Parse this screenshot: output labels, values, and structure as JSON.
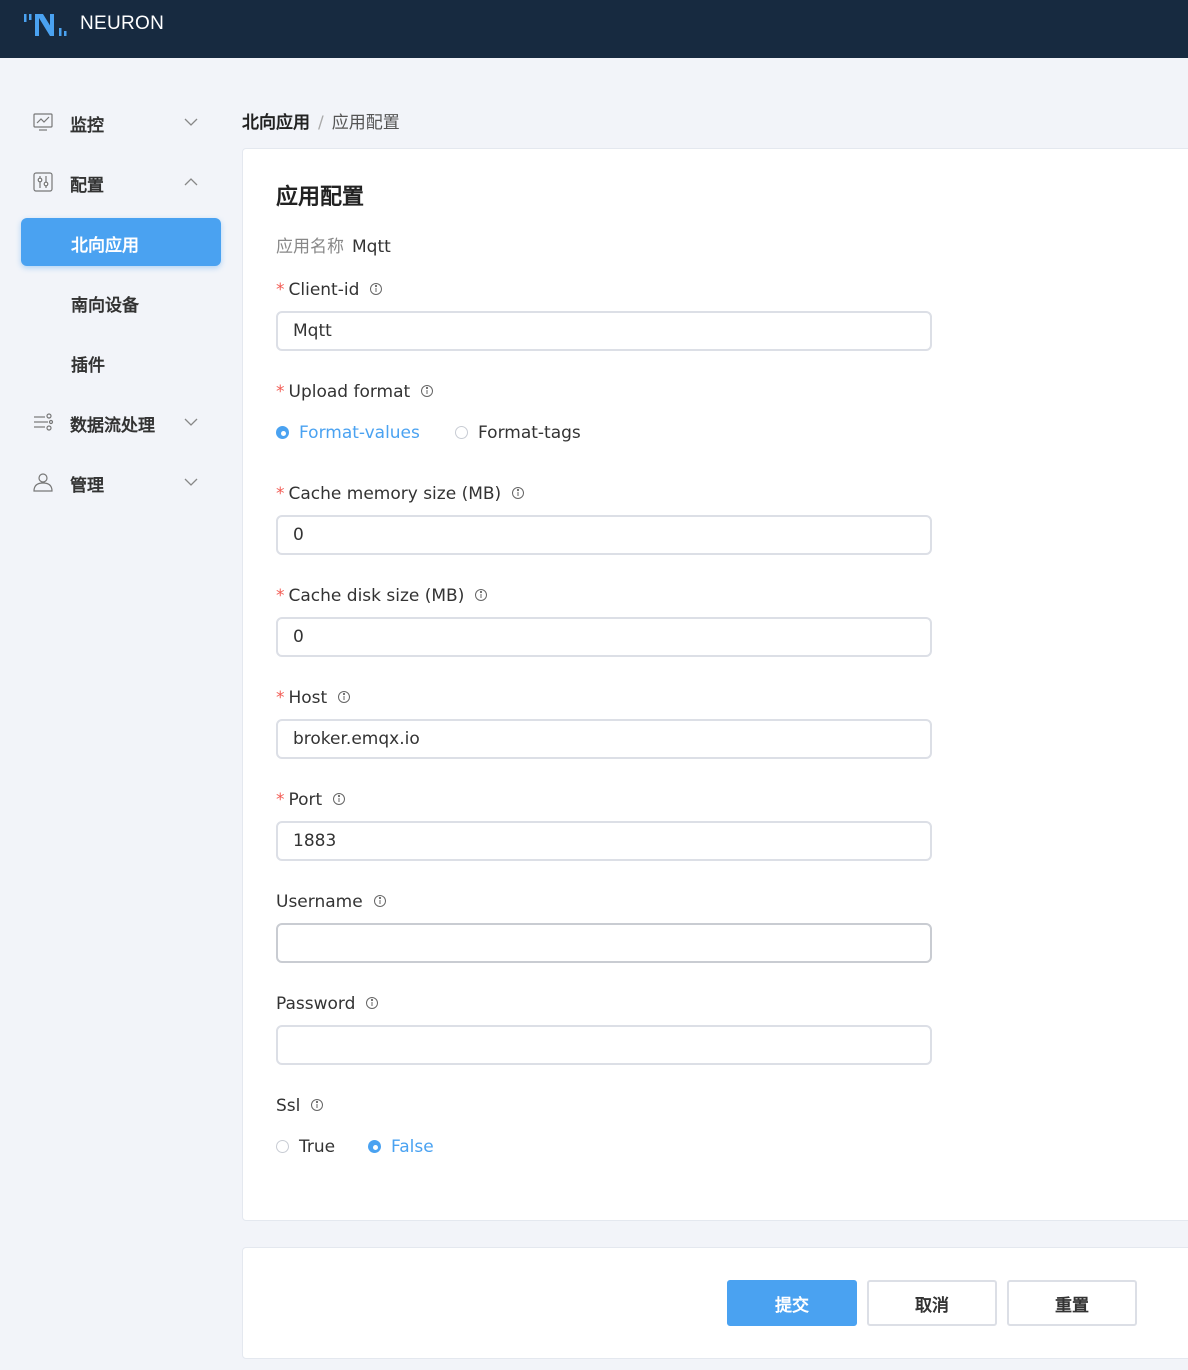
{
  "app": {
    "brand": "NEURON"
  },
  "sidebar": {
    "items": [
      {
        "label": "监控",
        "icon": "monitor-icon",
        "expanded": false
      },
      {
        "label": "配置",
        "icon": "config-icon",
        "expanded": true
      },
      {
        "label": "数据流处理",
        "icon": "dataflow-icon",
        "expanded": false
      },
      {
        "label": "管理",
        "icon": "user-icon",
        "expanded": false
      }
    ],
    "config_sub": [
      {
        "label": "北向应用",
        "active": true
      },
      {
        "label": "南向设备",
        "active": false
      },
      {
        "label": "插件",
        "active": false
      }
    ]
  },
  "breadcrumb": {
    "parent": "北向应用",
    "separator": "/",
    "current": "应用配置"
  },
  "form": {
    "title": "应用配置",
    "app_name_label": "应用名称",
    "app_name_value": "Mqtt",
    "fields": {
      "client_id": {
        "label": "Client-id",
        "required": true,
        "value": "Mqtt"
      },
      "upload_format": {
        "label": "Upload format",
        "required": true,
        "options": [
          "Format-values",
          "Format-tags"
        ],
        "selected": "Format-values"
      },
      "cache_memory": {
        "label": "Cache memory size (MB)",
        "required": true,
        "value": "0"
      },
      "cache_disk": {
        "label": "Cache disk size (MB)",
        "required": true,
        "value": "0"
      },
      "host": {
        "label": "Host",
        "required": true,
        "value": "broker.emqx.io"
      },
      "port": {
        "label": "Port",
        "required": true,
        "value": "1883"
      },
      "username": {
        "label": "Username",
        "required": false,
        "value": ""
      },
      "password": {
        "label": "Password",
        "required": false,
        "value": ""
      },
      "ssl": {
        "label": "Ssl",
        "required": false,
        "options": [
          "True",
          "False"
        ],
        "selected": "False"
      }
    },
    "required_mark": "*"
  },
  "actions": {
    "submit": "提交",
    "cancel": "取消",
    "reset": "重置"
  },
  "colors": {
    "header_bg": "#172a40",
    "accent": "#4aa2f1",
    "required": "#f25c54"
  }
}
